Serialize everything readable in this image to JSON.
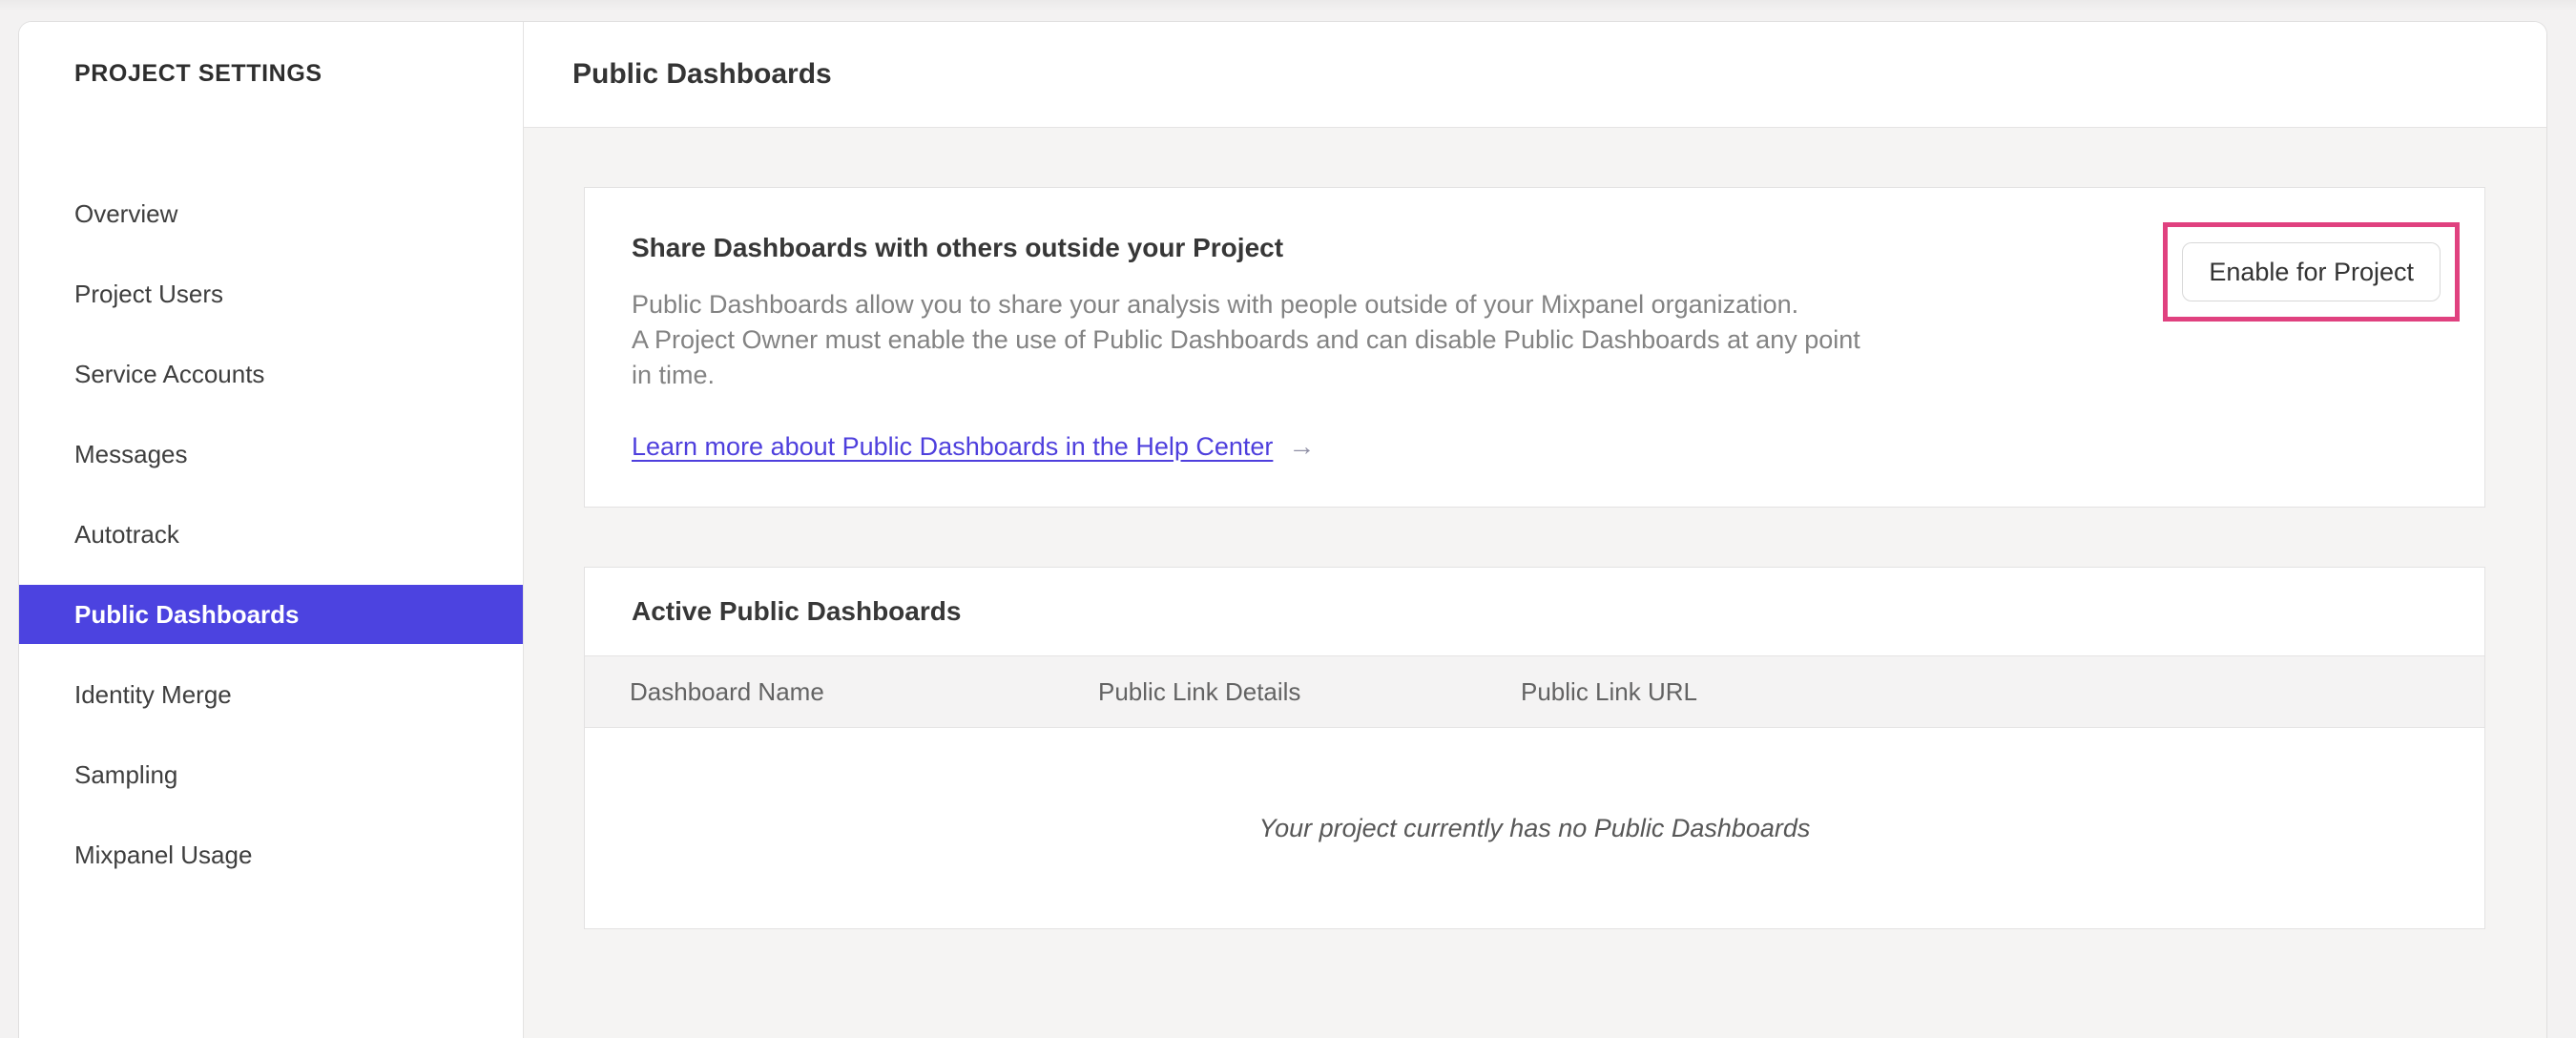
{
  "colors": {
    "selected_nav_purple": "#4C43E0",
    "link_purple": "#4E3FDD",
    "highlight_pink": "#E0417F"
  },
  "sidebar": {
    "title": "PROJECT SETTINGS",
    "items": [
      {
        "label": "Overview",
        "selected": false
      },
      {
        "label": "Project Users",
        "selected": false
      },
      {
        "label": "Service Accounts",
        "selected": false
      },
      {
        "label": "Messages",
        "selected": false
      },
      {
        "label": "Autotrack",
        "selected": false
      },
      {
        "label": "Public Dashboards",
        "selected": true
      },
      {
        "label": "Identity Merge",
        "selected": false
      },
      {
        "label": "Sampling",
        "selected": false
      },
      {
        "label": "Mixpanel Usage",
        "selected": false
      }
    ]
  },
  "header": {
    "title": "Public Dashboards"
  },
  "share_card": {
    "heading": "Share Dashboards with others outside your Project",
    "body_line1": "Public Dashboards allow you to share your analysis with people outside of your Mixpanel organization.",
    "body_line2": "A Project Owner must enable the use of Public Dashboards and can disable Public Dashboards at any point",
    "body_line3": "in time.",
    "link_label": "Learn more about Public Dashboards in the Help Center",
    "link_arrow": "→",
    "enable_button_label": "Enable for Project"
  },
  "active_dashboards_card": {
    "title": "Active Public Dashboards",
    "columns": [
      "Dashboard Name",
      "Public Link Details",
      "Public Link URL"
    ],
    "empty_message": "Your project currently has no Public Dashboards"
  }
}
